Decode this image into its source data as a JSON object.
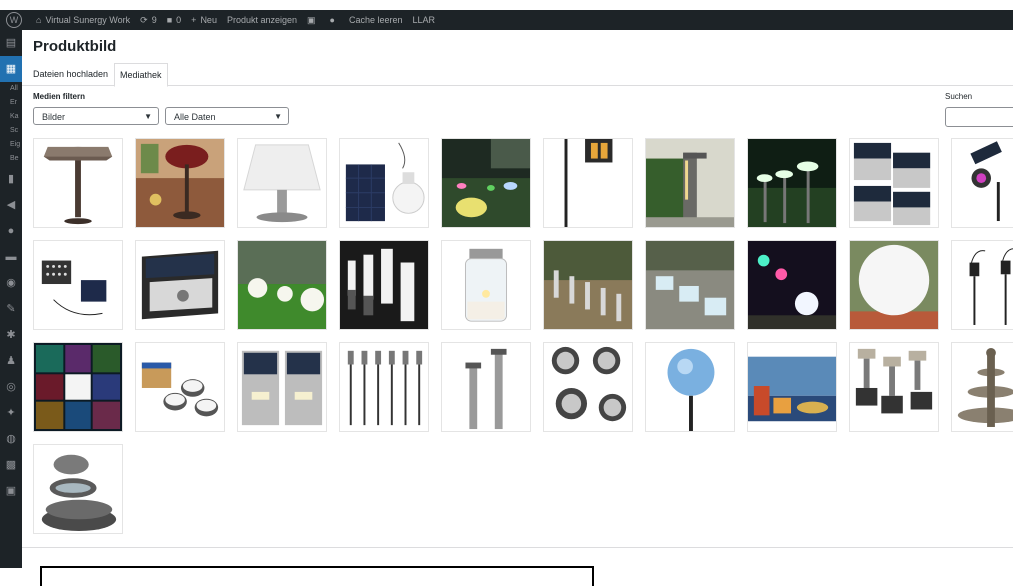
{
  "admin_bar": {
    "site_name": "Virtual Sunergy Work",
    "updates_count": "9",
    "comments_count": "0",
    "new_label": "Neu",
    "view_product_label": "Produkt anzeigen",
    "cache_label": "Cache leeren",
    "llar_label": "LLAR"
  },
  "sidebar": {
    "texts": [
      "All",
      "Er",
      "Ka",
      "Sc",
      "Eig",
      "Be"
    ]
  },
  "modal": {
    "title": "Produktbild",
    "tabs": [
      "Dateien hochladen",
      "Mediathek"
    ],
    "filter_label": "Medien filtern",
    "type_filter": "Bilder",
    "date_filter": "Alle Daten",
    "search_label": "Suchen"
  },
  "media_items": [
    "lamp-mosaic-shade",
    "lamp-red-table",
    "lamp-white-table",
    "solar-panel-bulb",
    "glowing-stones-garden",
    "lantern-post",
    "bollard-path-light",
    "garden-stake-lights",
    "wall-lights-pack",
    "spotlight-rgb",
    "floodlight-solar",
    "wall-sensor-light",
    "garden-ball-lights",
    "tube-lights-night",
    "mason-jar-light",
    "stake-lights-path",
    "paver-lights",
    "colorful-ball-lights",
    "white-globe-lamp",
    "lantern-stakes",
    "rgb-lights-collage",
    "puck-lights-box",
    "wall-lights-pair",
    "stake-lights-set",
    "bollard-pair",
    "disk-lights-set",
    "blue-globe-stake",
    "lantern-lake",
    "stake-lights-steel",
    "fountain-tier",
    "fountain-stone"
  ]
}
